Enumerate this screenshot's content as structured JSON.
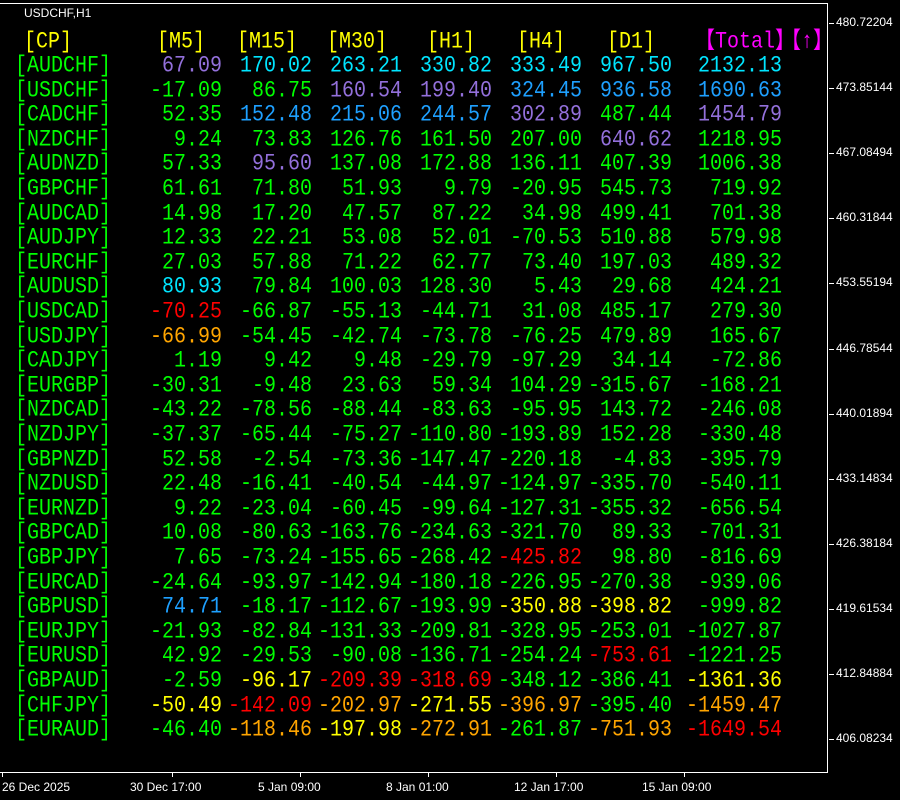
{
  "chart_title": "USDCHF,H1",
  "colors": {
    "G": "#00ff00",
    "C": "#00e5ff",
    "B": "#1ea0ff",
    "P": "#9370db",
    "Y": "#ffff00",
    "O": "#ffa500",
    "R": "#ff0000"
  },
  "headers": [
    "[CP]",
    "[M5]",
    "[M15]",
    "[M30]",
    "[H1]",
    "[H4]",
    "[D1]",
    "【Total】",
    "【↑】"
  ],
  "rows": [
    {
      "pair": "[AUDCHF]",
      "values": [
        "67.09",
        "170.02",
        "263.21",
        "330.82",
        "333.49",
        "967.50",
        "2132.13"
      ],
      "colors": "PCCCCCC"
    },
    {
      "pair": "[USDCHF]",
      "values": [
        "-17.09",
        "86.75",
        "160.54",
        "199.40",
        "324.45",
        "936.58",
        "1690.63"
      ],
      "colors": "GGPPBBB"
    },
    {
      "pair": "[CADCHF]",
      "values": [
        "52.35",
        "152.48",
        "215.06",
        "244.57",
        "302.89",
        "487.44",
        "1454.79"
      ],
      "colors": "GBBBPGP"
    },
    {
      "pair": "[NZDCHF]",
      "values": [
        "9.24",
        "73.83",
        "126.76",
        "161.50",
        "207.00",
        "640.62",
        "1218.95"
      ],
      "colors": "GGGGGPG"
    },
    {
      "pair": "[AUDNZD]",
      "values": [
        "57.33",
        "95.60",
        "137.08",
        "172.88",
        "136.11",
        "407.39",
        "1006.38"
      ],
      "colors": "GPGGGGG"
    },
    {
      "pair": "[GBPCHF]",
      "values": [
        "61.61",
        "71.80",
        "51.93",
        "9.79",
        "-20.95",
        "545.73",
        "719.92"
      ],
      "colors": "GGGGGGG"
    },
    {
      "pair": "[AUDCAD]",
      "values": [
        "14.98",
        "17.20",
        "47.57",
        "87.22",
        "34.98",
        "499.41",
        "701.38"
      ],
      "colors": "GGGGGGG"
    },
    {
      "pair": "[AUDJPY]",
      "values": [
        "12.33",
        "22.21",
        "53.08",
        "52.01",
        "-70.53",
        "510.88",
        "579.98"
      ],
      "colors": "GGGGGGG"
    },
    {
      "pair": "[EURCHF]",
      "values": [
        "27.03",
        "57.88",
        "71.22",
        "62.77",
        "73.40",
        "197.03",
        "489.32"
      ],
      "colors": "GGGGGGG"
    },
    {
      "pair": "[AUDUSD]",
      "values": [
        "80.93",
        "79.84",
        "100.03",
        "128.30",
        "5.43",
        "29.68",
        "424.21"
      ],
      "colors": "CGGGGGG"
    },
    {
      "pair": "[USDCAD]",
      "values": [
        "-70.25",
        "-66.87",
        "-55.13",
        "-44.71",
        "31.08",
        "485.17",
        "279.30"
      ],
      "colors": "RGGGGGG"
    },
    {
      "pair": "[USDJPY]",
      "values": [
        "-66.99",
        "-54.45",
        "-42.74",
        "-73.78",
        "-76.25",
        "479.89",
        "165.67"
      ],
      "colors": "OGGGGGG"
    },
    {
      "pair": "[CADJPY]",
      "values": [
        "1.19",
        "9.42",
        "9.48",
        "-29.79",
        "-97.29",
        "34.14",
        "-72.86"
      ],
      "colors": "GGGGGGG"
    },
    {
      "pair": "[EURGBP]",
      "values": [
        "-30.31",
        "-9.48",
        "23.63",
        "59.34",
        "104.29",
        "-315.67",
        "-168.21"
      ],
      "colors": "GGGGGGG"
    },
    {
      "pair": "[NZDCAD]",
      "values": [
        "-43.22",
        "-78.56",
        "-88.44",
        "-83.63",
        "-95.95",
        "143.72",
        "-246.08"
      ],
      "colors": "GGGGGGG"
    },
    {
      "pair": "[NZDJPY]",
      "values": [
        "-37.37",
        "-65.44",
        "-75.27",
        "-110.80",
        "-193.89",
        "152.28",
        "-330.48"
      ],
      "colors": "GGGGGGG"
    },
    {
      "pair": "[GBPNZD]",
      "values": [
        "52.58",
        "-2.54",
        "-73.36",
        "-147.47",
        "-220.18",
        "-4.83",
        "-395.79"
      ],
      "colors": "GGGGGGG"
    },
    {
      "pair": "[NZDUSD]",
      "values": [
        "22.48",
        "-16.41",
        "-40.54",
        "-44.97",
        "-124.97",
        "-335.70",
        "-540.11"
      ],
      "colors": "GGGGGGG"
    },
    {
      "pair": "[EURNZD]",
      "values": [
        "9.22",
        "-23.04",
        "-60.45",
        "-99.64",
        "-127.31",
        "-355.32",
        "-656.54"
      ],
      "colors": "GGGGGGG"
    },
    {
      "pair": "[GBPCAD]",
      "values": [
        "10.08",
        "-80.63",
        "-163.76",
        "-234.63",
        "-321.70",
        "89.33",
        "-701.31"
      ],
      "colors": "GGGGGGG"
    },
    {
      "pair": "[GBPJPY]",
      "values": [
        "7.65",
        "-73.24",
        "-155.65",
        "-268.42",
        "-425.82",
        "98.80",
        "-816.69"
      ],
      "colors": "GGGGRGG"
    },
    {
      "pair": "[EURCAD]",
      "values": [
        "-24.64",
        "-93.97",
        "-142.94",
        "-180.18",
        "-226.95",
        "-270.38",
        "-939.06"
      ],
      "colors": "GGGGGGG"
    },
    {
      "pair": "[GBPUSD]",
      "values": [
        "74.71",
        "-18.17",
        "-112.67",
        "-193.99",
        "-350.88",
        "-398.82",
        "-999.82"
      ],
      "colors": "BGGGYYG"
    },
    {
      "pair": "[EURJPY]",
      "values": [
        "-21.93",
        "-82.84",
        "-131.33",
        "-209.81",
        "-328.95",
        "-253.01",
        "-1027.87"
      ],
      "colors": "GGGGGGG"
    },
    {
      "pair": "[EURUSD]",
      "values": [
        "42.92",
        "-29.53",
        "-90.08",
        "-136.71",
        "-254.24",
        "-753.61",
        "-1221.25"
      ],
      "colors": "GGGGGRG"
    },
    {
      "pair": "[GBPAUD]",
      "values": [
        "-2.59",
        "-96.17",
        "-209.39",
        "-318.69",
        "-348.12",
        "-386.41",
        "-1361.36"
      ],
      "colors": "GYRRGGY"
    },
    {
      "pair": "[CHFJPY]",
      "values": [
        "-50.49",
        "-142.09",
        "-202.97",
        "-271.55",
        "-396.97",
        "-395.40",
        "-1459.47"
      ],
      "colors": "YROYOGO"
    },
    {
      "pair": "[EURAUD]",
      "values": [
        "-46.40",
        "-118.46",
        "-197.98",
        "-272.91",
        "-261.87",
        "-751.93",
        "-1649.54"
      ],
      "colors": "GOYOGOR"
    }
  ],
  "price_axis": [
    "480.72204",
    "473.85144",
    "467.08494",
    "460.31844",
    "453.55194",
    "446.78544",
    "440.01894",
    "433.14834",
    "426.38184",
    "419.61534",
    "412.84884",
    "406.08234"
  ],
  "time_axis": [
    "26 Dec 2025",
    "30 Dec 17:00",
    "5 Jan 09:00",
    "8 Jan 01:00",
    "12 Jan 17:00",
    "15 Jan 09:00"
  ]
}
